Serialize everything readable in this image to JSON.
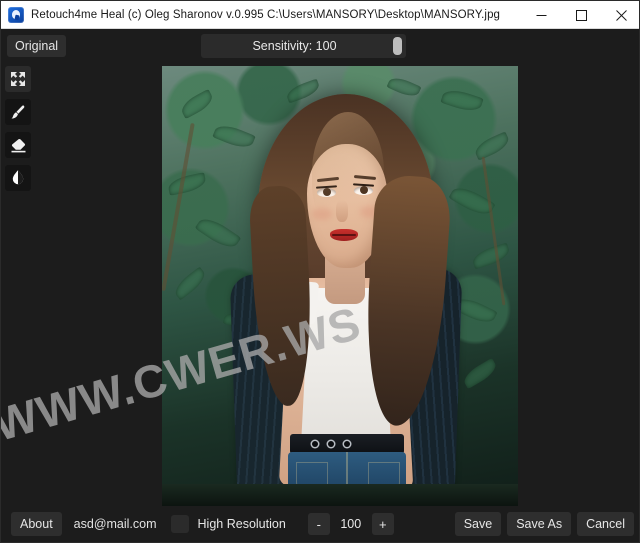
{
  "window": {
    "title": "Retouch4me Heal (c) Oleg Sharonov v.0.995 C:\\Users\\MANSORY\\Desktop\\MANSORY.jpg",
    "app_icon": "retouch4me-app-icon",
    "controls": {
      "minimize": "minimize-icon",
      "maximize": "maximize-icon",
      "close": "close-icon"
    }
  },
  "topbar": {
    "original_label": "Original",
    "sensitivity_label": "Sensitivity: 100",
    "sensitivity_value": 100,
    "sensitivity_min": 0,
    "sensitivity_max": 100
  },
  "tools": [
    {
      "name": "fit-to-screen-icon",
      "title": "Fit to screen"
    },
    {
      "name": "brush-icon",
      "title": "Brush"
    },
    {
      "name": "eraser-icon",
      "title": "Eraser"
    },
    {
      "name": "opacity-drop-icon",
      "title": "Opacity"
    }
  ],
  "canvas": {
    "watermark": "WWW.CWER.WS",
    "image_name": "MANSORY.jpg"
  },
  "bottombar": {
    "about_label": "About",
    "email": "asd@mail.com",
    "high_resolution_label": "High Resolution",
    "high_resolution_checked": false,
    "minus_label": "-",
    "amount_value": "100",
    "plus_label": "+",
    "save_label": "Save",
    "save_as_label": "Save As",
    "cancel_label": "Cancel"
  },
  "colors": {
    "window_bg": "#1c1c1c",
    "button_bg": "#2e2e2e",
    "titlebar_bg": "#ffffff",
    "text": "#e6e6e6",
    "slider_handle": "#bdbdbd"
  }
}
